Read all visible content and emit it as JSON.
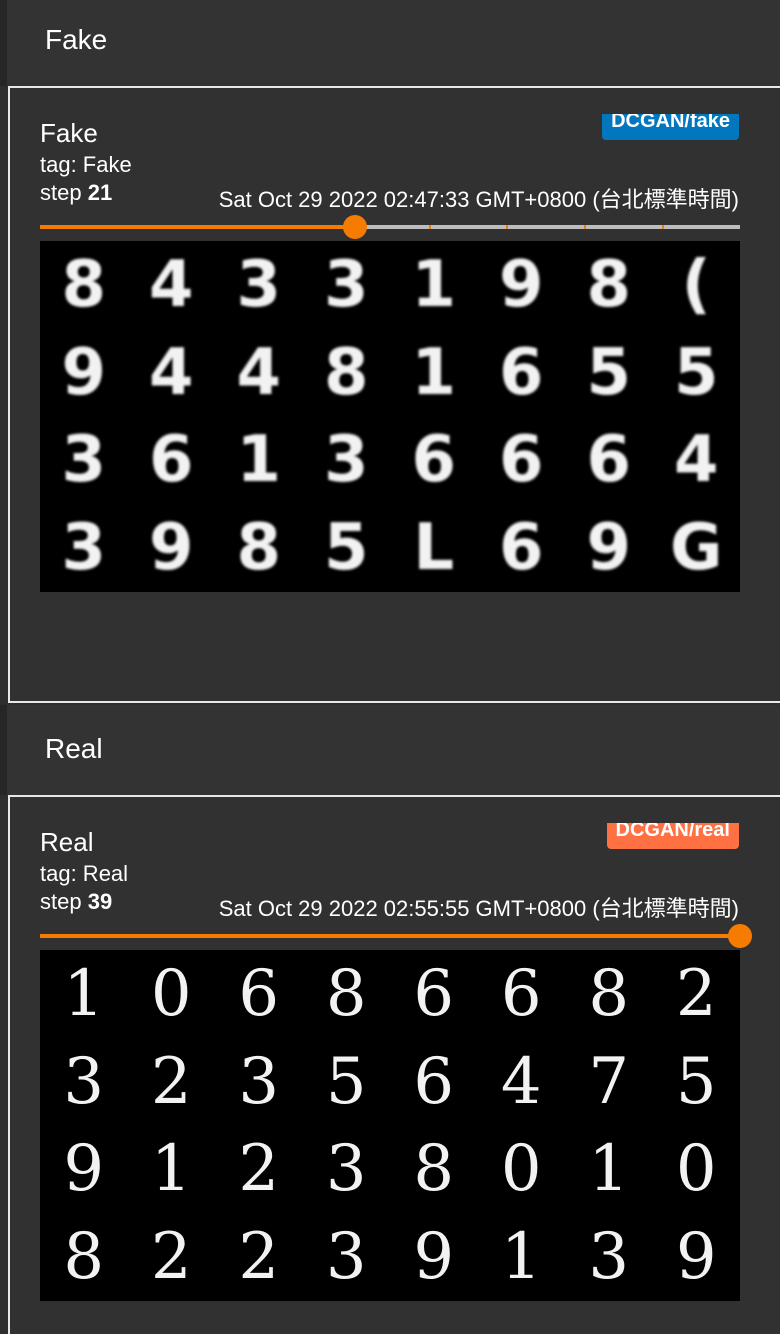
{
  "fake_section": {
    "header_title": "Fake",
    "card": {
      "title": "Fake",
      "tag_label": "tag: Fake",
      "step_label": "step",
      "step_value": "21",
      "timestamp": "Sat Oct 29 2022 02:47:33 GMT+0800 (台北標準時間)",
      "run_badge": "DCGAN/fake",
      "run_color": "#0277bd",
      "step_progress": 0.45,
      "digits": [
        "8",
        "4",
        "3",
        "3",
        "1",
        "9",
        "8",
        "(",
        "9",
        "4",
        "4",
        "8",
        "1",
        "6",
        "5",
        "5",
        "3",
        "6",
        "1",
        "3",
        "6",
        "6",
        "6",
        "4",
        "3",
        "9",
        "8",
        "5",
        "L",
        "6",
        "9",
        "G"
      ]
    }
  },
  "real_section": {
    "header_title": "Real",
    "card": {
      "title": "Real",
      "tag_label": "tag: Real",
      "step_label": "step",
      "step_value": "39",
      "timestamp": "Sat Oct 29 2022 02:55:55 GMT+0800 (台北標準時間)",
      "run_badge": "DCGAN/real",
      "run_color": "#ff7043",
      "step_progress": 1.0,
      "digits": [
        "1",
        "0",
        "6",
        "8",
        "6",
        "6",
        "8",
        "2",
        "3",
        "2",
        "3",
        "5",
        "6",
        "4",
        "7",
        "5",
        "9",
        "1",
        "2",
        "3",
        "8",
        "0",
        "1",
        "0",
        "8",
        "2",
        "2",
        "3",
        "9",
        "1",
        "3",
        "9"
      ]
    }
  },
  "colors": {
    "accent": "#f57c00"
  }
}
